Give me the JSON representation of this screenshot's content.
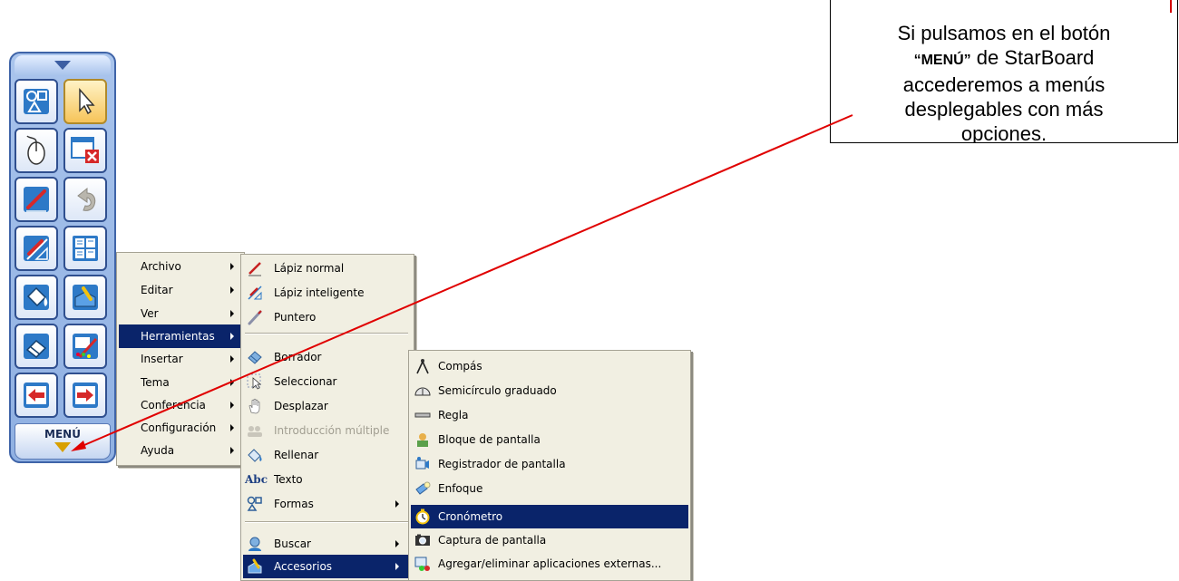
{
  "callout": {
    "line1": "Si pulsamos en el botón",
    "line2_kw": "“MENÚ”",
    "line2_rest": " de StarBoard",
    "line3": "accederemos a menús",
    "line4": "desplegables con más",
    "line5": "opciones."
  },
  "toolbar": {
    "collapse_icon": "triangle-down-icon",
    "buttons": [
      {
        "icon": "shapes-icon"
      },
      {
        "icon": "pointer-arrow-icon"
      },
      {
        "icon": "mouse-icon"
      },
      {
        "icon": "close-window-icon"
      },
      {
        "icon": "pen-icon"
      },
      {
        "icon": "undo-icon"
      },
      {
        "icon": "smart-pen-icon"
      },
      {
        "icon": "layout-icon"
      },
      {
        "icon": "fill-bucket-icon"
      },
      {
        "icon": "toolbox-icon"
      },
      {
        "icon": "eraser-icon"
      },
      {
        "icon": "edit-palette-icon"
      },
      {
        "icon": "previous-page-icon"
      },
      {
        "icon": "next-page-icon"
      }
    ],
    "menu_label": "MENÚ",
    "colors": {
      "frame": "#8fb0e2",
      "border": "#3f64a8",
      "selected": "#f6c45a",
      "arrow": "#d40000"
    }
  },
  "main_menu": {
    "items": [
      {
        "label": "Archivo",
        "submenu": true
      },
      {
        "label": "Editar",
        "submenu": true
      },
      {
        "label": "Ver",
        "submenu": true
      },
      {
        "label": "Herramientas",
        "submenu": true,
        "highlighted": true
      },
      {
        "label": "Insertar",
        "submenu": true
      },
      {
        "label": "Tema",
        "submenu": true
      },
      {
        "label": "Conferencia",
        "submenu": true
      },
      {
        "label": "Configuración",
        "submenu": true
      },
      {
        "label": "Ayuda",
        "submenu": true
      }
    ]
  },
  "tools_menu": {
    "items": [
      {
        "label": "Lápiz normal",
        "icon": "pen-icon"
      },
      {
        "label": "Lápiz inteligente",
        "icon": "smart-pen-icon"
      },
      {
        "label": "Puntero",
        "icon": "pointer-icon"
      },
      {
        "label": "Borrador",
        "icon": "eraser-icon"
      },
      {
        "label": "Seleccionar",
        "icon": "select-icon"
      },
      {
        "label": "Desplazar",
        "icon": "hand-icon"
      },
      {
        "label": "Introducción múltiple",
        "icon": "multi-input-icon",
        "disabled": true
      },
      {
        "label": "Rellenar",
        "icon": "fill-bucket-icon"
      },
      {
        "label": "Texto",
        "icon": "text-icon",
        "icon_text": "Abc"
      },
      {
        "label": "Formas",
        "icon": "shapes-icon",
        "submenu": true
      },
      {
        "label": "Buscar",
        "icon": "search-icon",
        "submenu": true
      },
      {
        "label": "Accesorios",
        "icon": "accessories-icon",
        "submenu": true,
        "highlighted": true
      }
    ]
  },
  "accessories_menu": {
    "items": [
      {
        "label": "Compás",
        "icon": "compass-icon"
      },
      {
        "label": "Semicírculo graduado",
        "icon": "protractor-icon"
      },
      {
        "label": "Regla",
        "icon": "ruler-icon"
      },
      {
        "label": "Bloque de pantalla",
        "icon": "screen-block-icon"
      },
      {
        "label": "Registrador de pantalla",
        "icon": "screen-recorder-icon"
      },
      {
        "label": "Enfoque",
        "icon": "spotlight-icon"
      },
      {
        "label": "Cronómetro",
        "icon": "stopwatch-icon",
        "highlighted": true
      },
      {
        "label": "Captura de pantalla",
        "icon": "camera-icon"
      },
      {
        "label": "Agregar/eliminar aplicaciones externas...",
        "icon": "add-remove-apps-icon"
      }
    ]
  }
}
